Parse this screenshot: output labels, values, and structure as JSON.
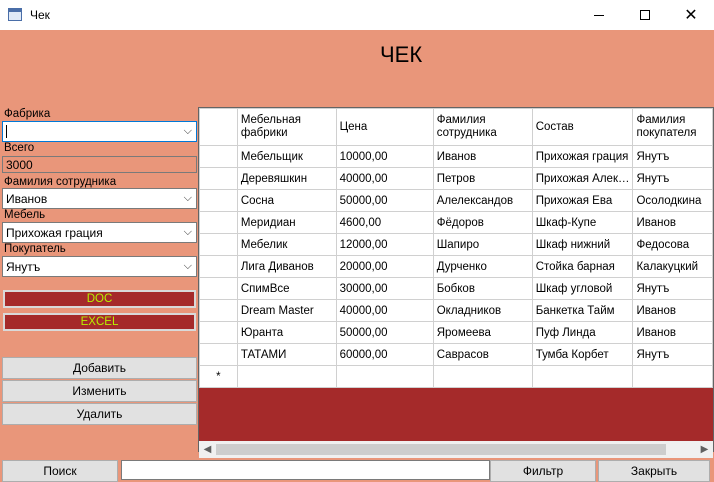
{
  "window": {
    "title": "Чек"
  },
  "header": {
    "title": "ЧЕК"
  },
  "form": {
    "factory_label": "Фабрика",
    "factory_value": "",
    "total_label": "Всего",
    "total_value": "3000",
    "employee_label": "Фамилия сотрудника",
    "employee_value": "Иванов",
    "furniture_label": "Мебель",
    "furniture_value": "Прихожая грация",
    "buyer_label": "Покупатель",
    "buyer_value": "Янутъ"
  },
  "export": {
    "doc_label": "DOC",
    "excel_label": "EXCEL"
  },
  "actions": {
    "add_label": "Добавить",
    "edit_label": "Изменить",
    "delete_label": "Удалить"
  },
  "table": {
    "headers": [
      "Мебельная фабрики",
      "Цена",
      "Фамилия сотрудника",
      "Состав",
      "Фамилия покупателя"
    ],
    "rows": [
      [
        "Мебельщик",
        "10000,00",
        "Иванов",
        "Прихожая грация",
        "Янутъ"
      ],
      [
        "Деревяшкин",
        "40000,00",
        "Петров",
        "Прихожая Алек…",
        "Янутъ"
      ],
      [
        "Сосна",
        "50000,00",
        "Алелександов",
        "Прихожая Ева",
        "Осолодкина"
      ],
      [
        "Меридиан",
        "4600,00",
        "Фёдоров",
        "Шкаф-Купе",
        "Иванов"
      ],
      [
        "Мебелик",
        "12000,00",
        "Шапиро",
        "Шкаф нижний",
        "Федосова"
      ],
      [
        "Лига Диванов",
        "20000,00",
        "Дурченко",
        "Стойка барная",
        "Калакуцкий"
      ],
      [
        "СпимВсе",
        "30000,00",
        "Бобков",
        "Шкаф угловой",
        "Янутъ"
      ],
      [
        "Dream Master",
        "40000,00",
        "Окладников",
        "Банкетка Тайм",
        "Иванов"
      ],
      [
        "Юранта",
        "50000,00",
        "Яромеева",
        "Пуф Линда",
        "Иванов"
      ],
      [
        "ТАТАМИ",
        "60000,00",
        "Саврасов",
        "Тумба Корбет",
        "Янутъ"
      ]
    ],
    "new_row_marker": "*"
  },
  "bottom": {
    "search_label": "Поиск",
    "search_value": "",
    "filter_label": "Фильтр",
    "close_label": "Закрыть"
  },
  "colors": {
    "background": "#e9967a",
    "accent_red": "#a52a2a",
    "button_text_green": "#b8f000"
  },
  "icons": {
    "app": "window-app-icon",
    "dropdown": "chevron-down-icon"
  }
}
